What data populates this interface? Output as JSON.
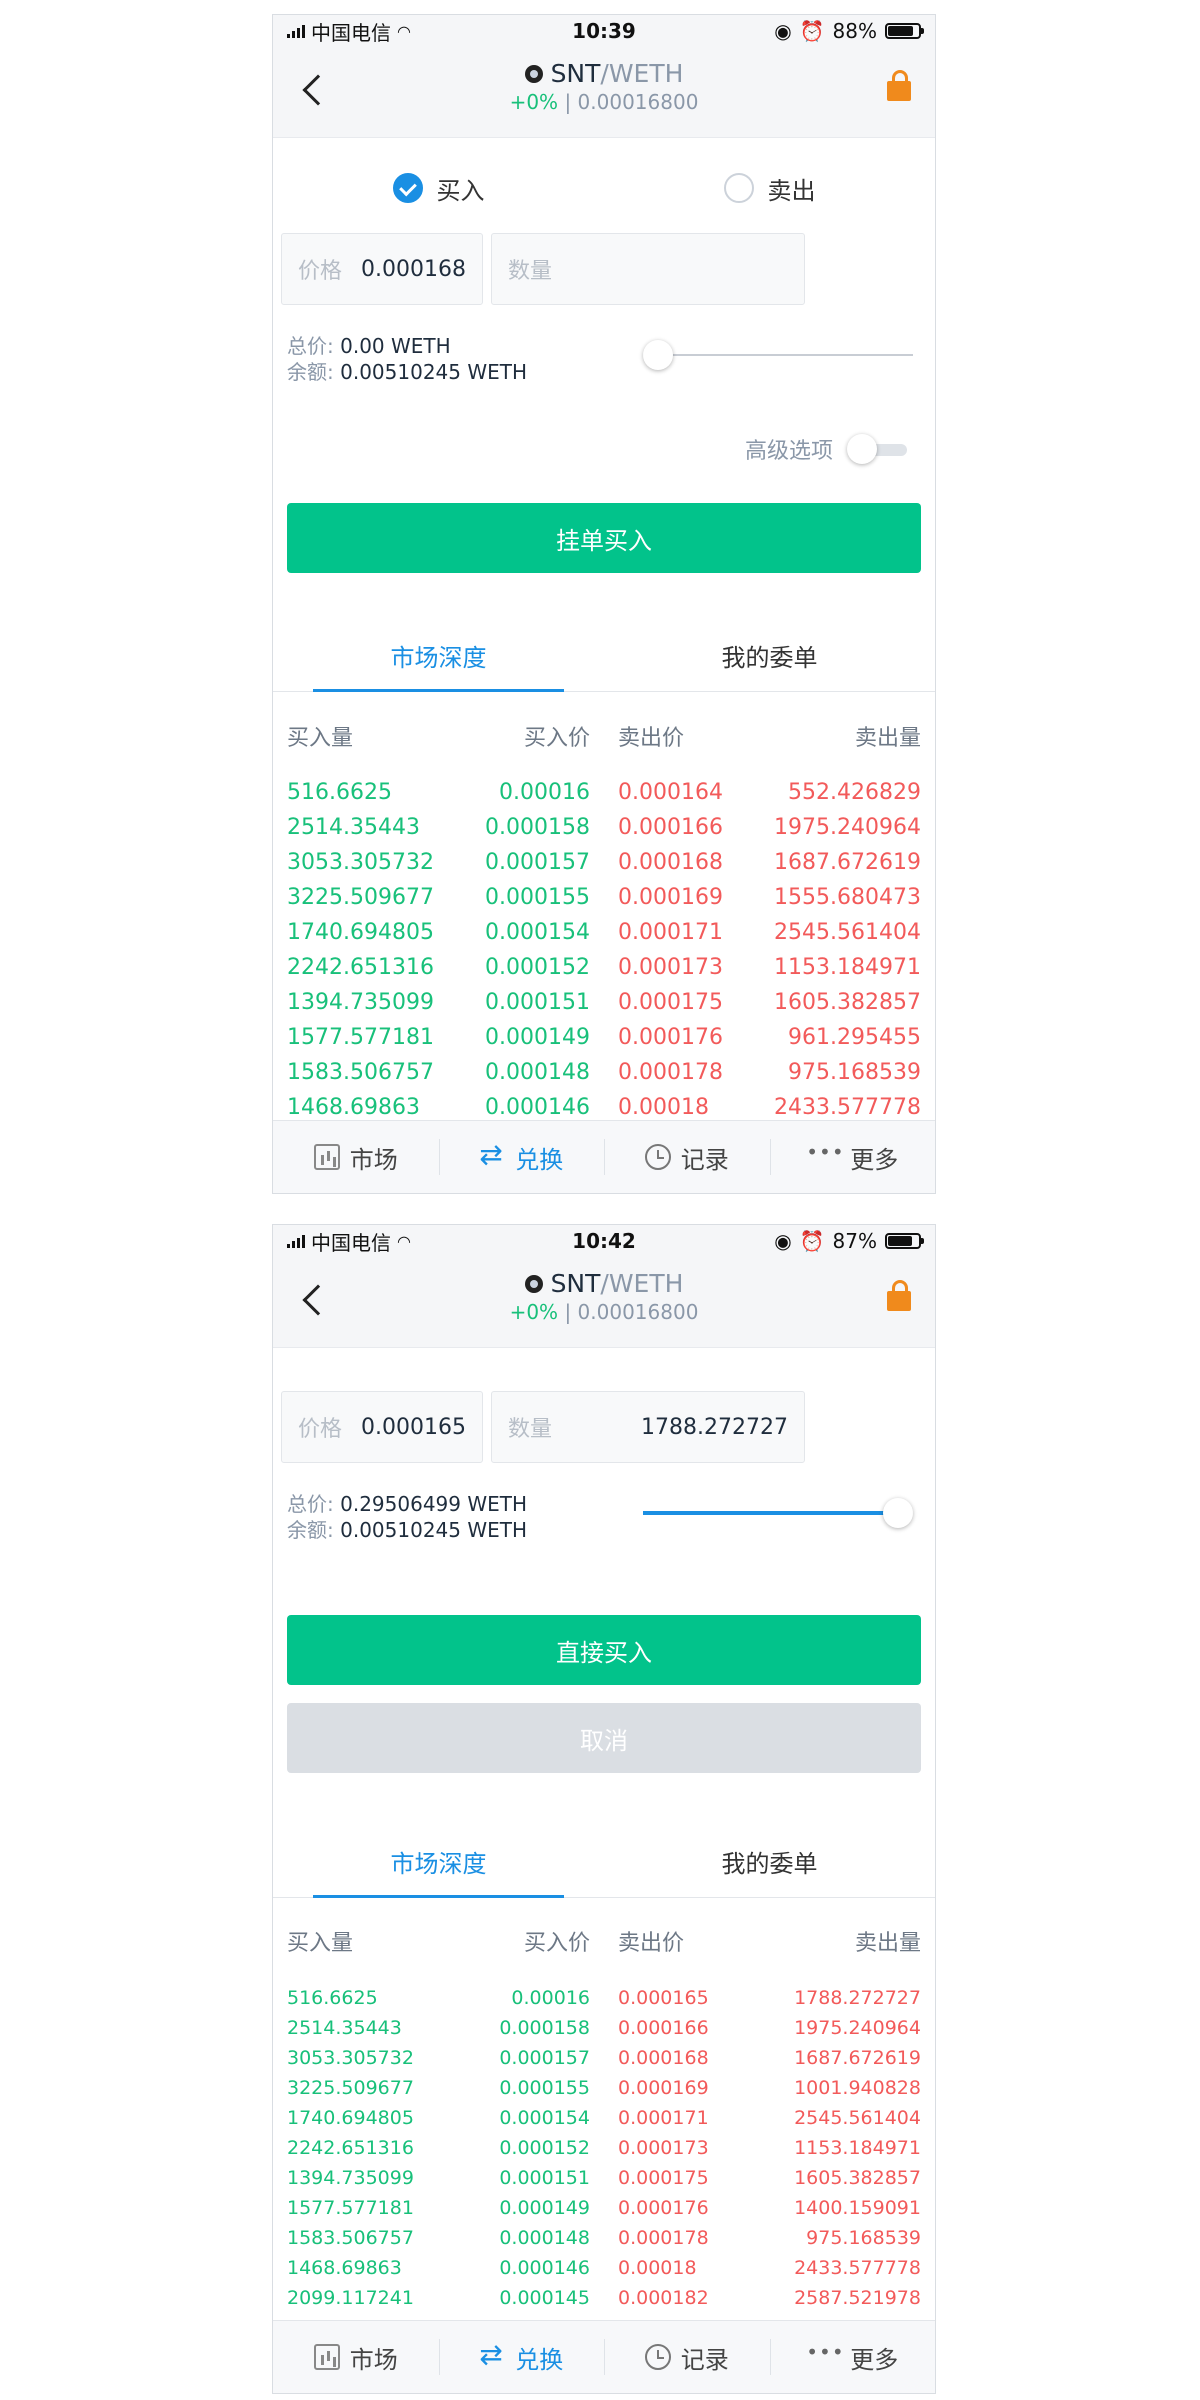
{
  "screens": [
    {
      "status": {
        "carrier": "中国电信",
        "time": "10:39",
        "battery": "88%",
        "battery_level": 0.88
      },
      "header": {
        "base": "SNT",
        "quote": "/WETH",
        "change": "+0%",
        "price": "| 0.00016800"
      },
      "radios": {
        "buy": "买入",
        "sell": "卖出",
        "selected": "buy"
      },
      "price_field": {
        "placeholder": "价格",
        "value": "0.000168"
      },
      "qty_field": {
        "placeholder": "数量",
        "value": ""
      },
      "totals": {
        "total_label": "总价:",
        "total_value": "0.00 WETH",
        "balance_label": "余额:",
        "balance_value": "0.00510245 WETH"
      },
      "slider_value": 0,
      "advanced": {
        "label": "高级选项",
        "on": false
      },
      "primary_button": "挂单买入",
      "tabs": [
        "市场深度",
        "我的委单"
      ],
      "headers": [
        "买入量",
        "买入价",
        "卖出价",
        "卖出量"
      ],
      "rows": [
        [
          "516.6625",
          "0.00016",
          "0.000164",
          "552.426829"
        ],
        [
          "2514.35443",
          "0.000158",
          "0.000166",
          "1975.240964"
        ],
        [
          "3053.305732",
          "0.000157",
          "0.000168",
          "1687.672619"
        ],
        [
          "3225.509677",
          "0.000155",
          "0.000169",
          "1555.680473"
        ],
        [
          "1740.694805",
          "0.000154",
          "0.000171",
          "2545.561404"
        ],
        [
          "2242.651316",
          "0.000152",
          "0.000173",
          "1153.184971"
        ],
        [
          "1394.735099",
          "0.000151",
          "0.000175",
          "1605.382857"
        ],
        [
          "1577.577181",
          "0.000149",
          "0.000176",
          "961.295455"
        ],
        [
          "1583.506757",
          "0.000148",
          "0.000178",
          "975.168539"
        ],
        [
          "1468.69863",
          "0.000146",
          "0.00018",
          "2433.577778"
        ]
      ],
      "tabbar": [
        "市场",
        "兑换",
        "记录",
        "更多"
      ]
    },
    {
      "status": {
        "carrier": "中国电信",
        "time": "10:42",
        "battery": "87%",
        "battery_level": 0.87
      },
      "header": {
        "base": "SNT",
        "quote": "/WETH",
        "change": "+0%",
        "price": "| 0.00016800"
      },
      "price_field": {
        "placeholder": "价格",
        "value": "0.000165"
      },
      "qty_field": {
        "placeholder": "数量",
        "value": "1788.272727"
      },
      "totals": {
        "total_label": "总价:",
        "total_value": "0.29506499 WETH",
        "balance_label": "余额:",
        "balance_value": "0.00510245 WETH"
      },
      "slider_value": 1,
      "primary_button": "直接买入",
      "cancel_button": "取消",
      "tabs": [
        "市场深度",
        "我的委单"
      ],
      "headers": [
        "买入量",
        "买入价",
        "卖出价",
        "卖出量"
      ],
      "rows": [
        [
          "516.6625",
          "0.00016",
          "0.000165",
          "1788.272727"
        ],
        [
          "2514.35443",
          "0.000158",
          "0.000166",
          "1975.240964"
        ],
        [
          "3053.305732",
          "0.000157",
          "0.000168",
          "1687.672619"
        ],
        [
          "3225.509677",
          "0.000155",
          "0.000169",
          "1001.940828"
        ],
        [
          "1740.694805",
          "0.000154",
          "0.000171",
          "2545.561404"
        ],
        [
          "2242.651316",
          "0.000152",
          "0.000173",
          "1153.184971"
        ],
        [
          "1394.735099",
          "0.000151",
          "0.000175",
          "1605.382857"
        ],
        [
          "1577.577181",
          "0.000149",
          "0.000176",
          "1400.159091"
        ],
        [
          "1583.506757",
          "0.000148",
          "0.000178",
          "975.168539"
        ],
        [
          "1468.69863",
          "0.000146",
          "0.00018",
          "2433.577778"
        ],
        [
          "2099.117241",
          "0.000145",
          "0.000182",
          "2587.521978"
        ]
      ],
      "tabbar": [
        "市场",
        "兑换",
        "记录",
        "更多"
      ]
    }
  ],
  "colors": {
    "buy": "#18c07a",
    "sell": "#f25a5a",
    "accent": "#1a8fe3",
    "button": "#02c38b"
  }
}
